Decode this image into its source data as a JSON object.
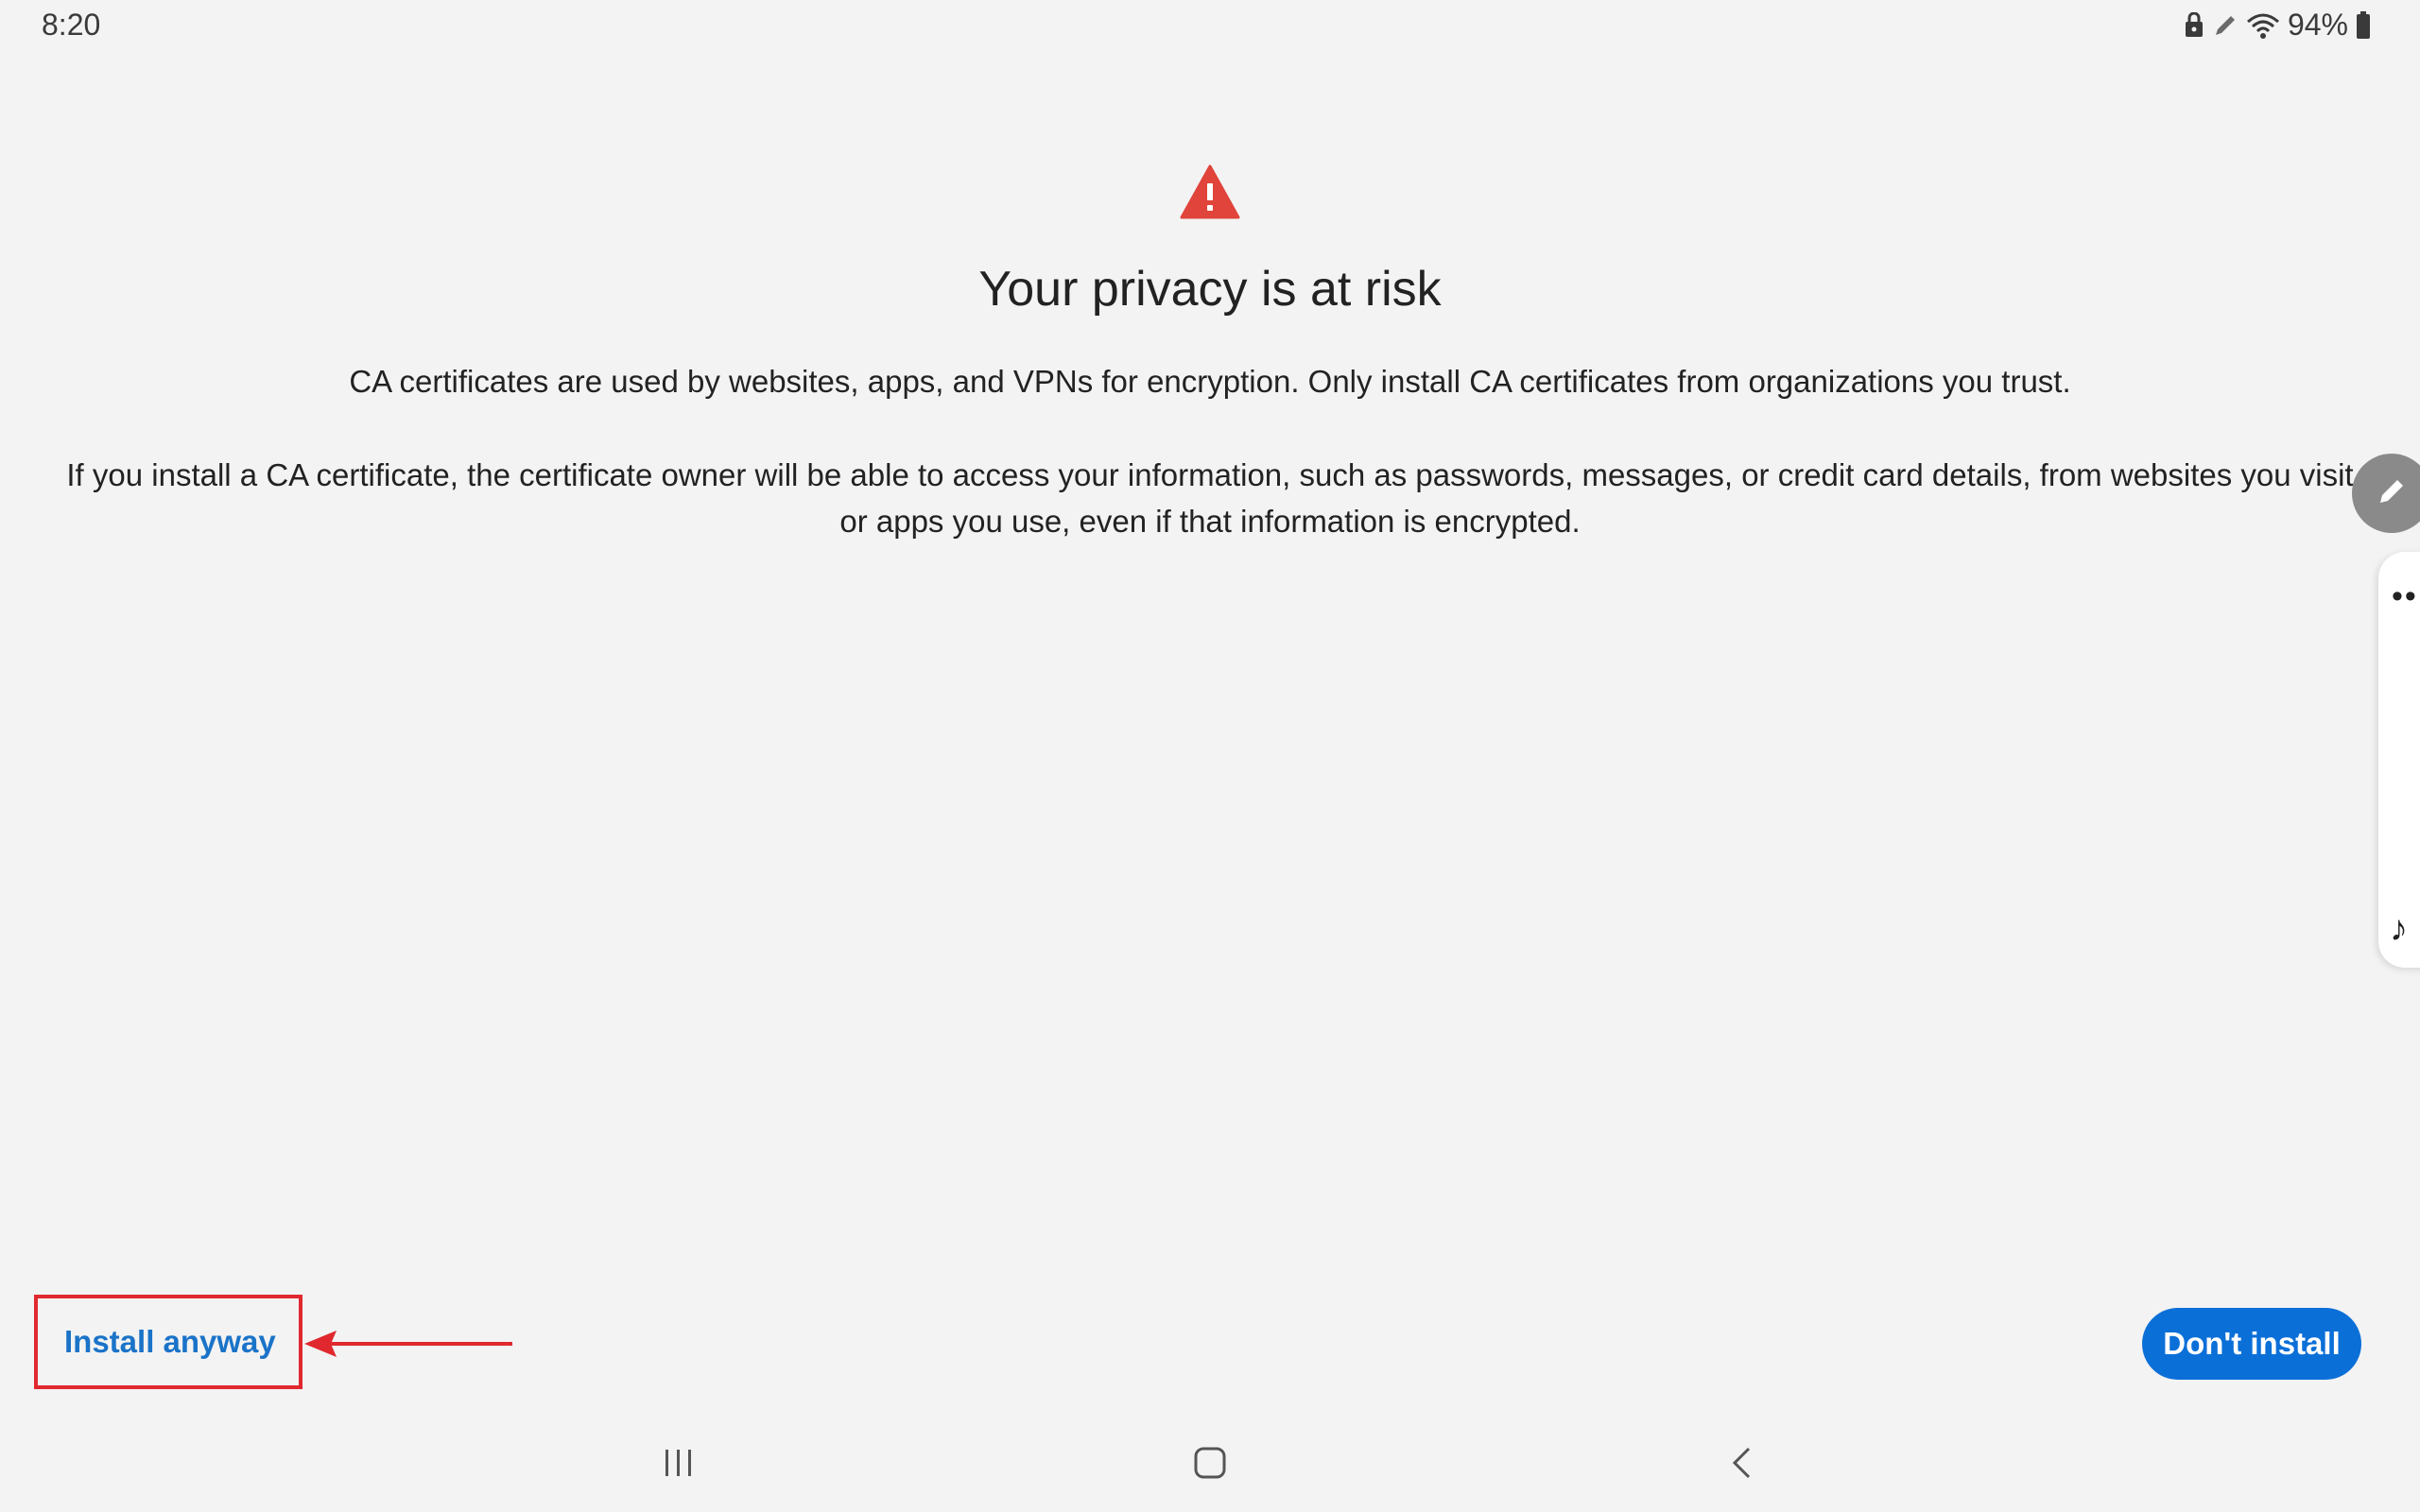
{
  "status_bar": {
    "time": "8:20",
    "battery": "94%",
    "icons": [
      "lock-icon",
      "pen-icon",
      "wifi-icon",
      "battery-icon"
    ]
  },
  "warning": {
    "icon": "warning-triangle-icon",
    "icon_color": "#e0443a",
    "title": "Your privacy is at risk",
    "paragraph1": "CA certificates are used by websites, apps, and VPNs for encryption. Only install CA certificates from organizations you trust.",
    "paragraph2": "If you install a CA certificate, the certificate owner will be able to access your information, such as passwords, messages, or credit card details, from websites you visit or apps you use, even if that information is encrypted."
  },
  "actions": {
    "install_anyway_label": "Install anyway",
    "dont_install_label": "Don't install",
    "primary_color": "#0b6fd8",
    "link_color": "#1a73c8",
    "highlight_color": "#e0282e"
  },
  "edge_panel": {
    "items": [
      "pen-icon",
      "more-dots-icon",
      "music-note-icon"
    ]
  },
  "nav_bar": {
    "items": [
      "recent-apps-icon",
      "home-icon",
      "back-icon"
    ]
  }
}
